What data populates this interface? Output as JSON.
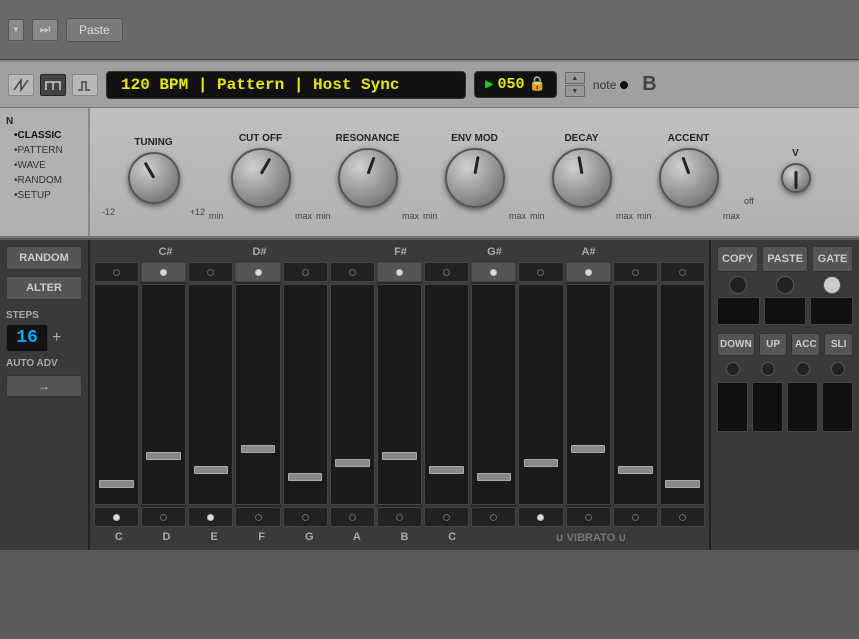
{
  "toolbar": {
    "dropdown_arrow": "▼",
    "skip_btn": "⏭",
    "paste_label": "Paste"
  },
  "transport": {
    "bpm_display": "120 BPM  |  Pattern  |  Host Sync",
    "pattern_num": "050",
    "play_icon": "▶",
    "note_label": "note",
    "up_arrow": "▲",
    "down_arrow": "▼"
  },
  "knobs": {
    "pattern_section_label": "N",
    "pattern_items": [
      "•CLASSIC",
      "•PATTERN",
      "•WAVE",
      "•RANDOM",
      "•SETUP"
    ],
    "groups": [
      {
        "label": "TUNING",
        "min": "-12",
        "max": "+12",
        "rotation": -30
      },
      {
        "label": "CUT OFF",
        "min": "min",
        "max": "max",
        "rotation": 30
      },
      {
        "label": "RESONANCE",
        "min": "min",
        "max": "max",
        "rotation": 20
      },
      {
        "label": "ENV MOD",
        "min": "min",
        "max": "max",
        "rotation": 10
      },
      {
        "label": "DECAY",
        "min": "min",
        "max": "max",
        "rotation": -10
      },
      {
        "label": "ACCENT",
        "min": "min",
        "max": "max",
        "rotation": -20
      }
    ],
    "last_label": "V",
    "last_range": "off"
  },
  "sequencer": {
    "random_label": "RANDOM",
    "alter_label": "ALTER",
    "steps_label": "STEPS",
    "steps_value": "16",
    "steps_plus": "+",
    "auto_adv_label": "AUTO ADV",
    "arrow_label": "→",
    "note_headers": [
      "C#",
      "D#",
      "",
      "F#",
      "G#",
      "A#",
      ""
    ],
    "bottom_notes": [
      "C",
      "D",
      "E",
      "F",
      "G",
      "A",
      "B",
      "C"
    ],
    "right_buttons": {
      "copy": "COPY",
      "paste": "PASTE",
      "gate": "GATE",
      "down": "DOWN",
      "up": "UP",
      "acc": "ACC",
      "sli": "SLI"
    },
    "vibrato_label": "∪ VIBRATO ∪"
  }
}
